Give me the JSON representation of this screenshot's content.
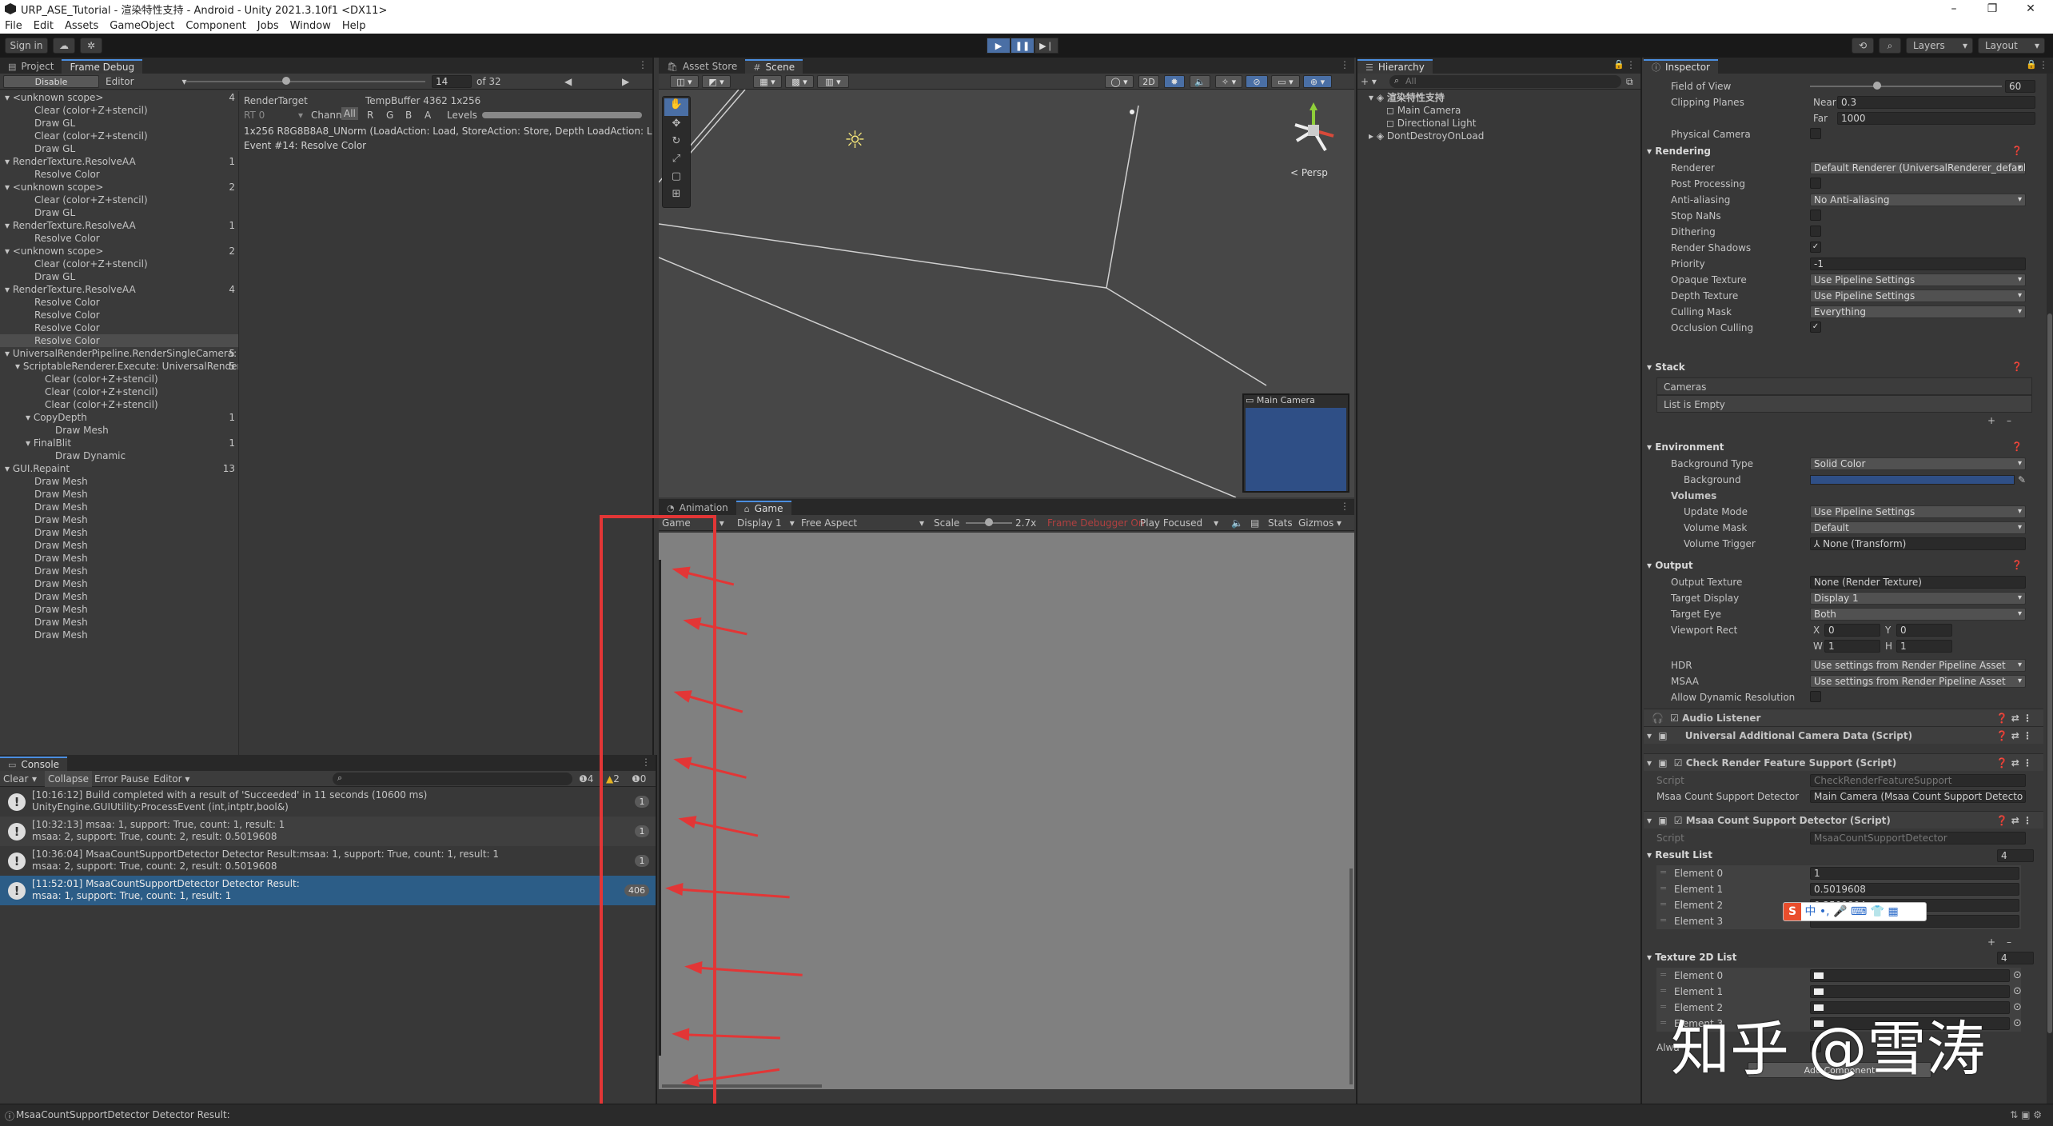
{
  "window": {
    "title": "URP_ASE_Tutorial - 渲染特性支持 - Android - Unity 2021.3.10f1 <DX11>",
    "controls": [
      "–",
      "❐",
      "✕"
    ]
  },
  "menu": [
    "File",
    "Edit",
    "Assets",
    "GameObject",
    "Component",
    "Jobs",
    "Window",
    "Help"
  ],
  "toolbar": {
    "sign_in": "Sign in",
    "layers": "Layers",
    "layout": "Layout"
  },
  "left_panel": {
    "tabs": [
      "Project",
      "Frame Debug"
    ],
    "disable_btn": "Disable",
    "editor_dd": "Editor",
    "frame_value": "14",
    "frame_total": "of 32",
    "frame_fraction": 0.42,
    "render_target_label": "RenderTarget",
    "render_target_value": "TempBuffer 4362 1x256",
    "rt_label": "RT 0",
    "channels_label": "Channels",
    "channels": [
      "All",
      "R",
      "G",
      "B",
      "A"
    ],
    "levels_label": "Levels",
    "format_line": "1x256 R8G8B8A8_UNorm (LoadAction: Load, StoreAction: Store, Depth LoadAction: Load, D",
    "event_line": "Event #14: Resolve Color",
    "events": [
      {
        "text": "▾ <unknown scope>",
        "count": "4",
        "indent": 0
      },
      {
        "text": "Clear (color+Z+stencil)",
        "count": "",
        "indent": 1
      },
      {
        "text": "Draw GL",
        "count": "",
        "indent": 1
      },
      {
        "text": "Clear (color+Z+stencil)",
        "count": "",
        "indent": 1
      },
      {
        "text": "Draw GL",
        "count": "",
        "indent": 1
      },
      {
        "text": "▾ RenderTexture.ResolveAA",
        "count": "1",
        "indent": 0
      },
      {
        "text": "Resolve Color",
        "count": "",
        "indent": 1
      },
      {
        "text": "▾ <unknown scope>",
        "count": "2",
        "indent": 0
      },
      {
        "text": "Clear (color+Z+stencil)",
        "count": "",
        "indent": 1
      },
      {
        "text": "Draw GL",
        "count": "",
        "indent": 1
      },
      {
        "text": "▾ RenderTexture.ResolveAA",
        "count": "1",
        "indent": 0
      },
      {
        "text": "Resolve Color",
        "count": "",
        "indent": 1
      },
      {
        "text": "▾ <unknown scope>",
        "count": "2",
        "indent": 0
      },
      {
        "text": "Clear (color+Z+stencil)",
        "count": "",
        "indent": 1
      },
      {
        "text": "Draw GL",
        "count": "",
        "indent": 1
      },
      {
        "text": "▾ RenderTexture.ResolveAA",
        "count": "4",
        "indent": 0
      },
      {
        "text": "Resolve Color",
        "count": "",
        "indent": 1
      },
      {
        "text": "Resolve Color",
        "count": "",
        "indent": 1
      },
      {
        "text": "Resolve Color",
        "count": "",
        "indent": 1
      },
      {
        "text": "Resolve Color",
        "count": "",
        "indent": 1,
        "selected": true
      },
      {
        "text": "▾ UniversalRenderPipeline.RenderSingleCamera: I",
        "count": "5",
        "indent": 0
      },
      {
        "text": "▾ ScriptableRenderer.Execute: UniversalRender",
        "count": "5",
        "indent": 1
      },
      {
        "text": "Clear (color+Z+stencil)",
        "count": "",
        "indent": 2
      },
      {
        "text": "Clear (color+Z+stencil)",
        "count": "",
        "indent": 2
      },
      {
        "text": "Clear (color+Z+stencil)",
        "count": "",
        "indent": 2
      },
      {
        "text": "▾ CopyDepth",
        "count": "1",
        "indent": 2
      },
      {
        "text": "Draw Mesh",
        "count": "",
        "indent": 3
      },
      {
        "text": "▾ FinalBlit",
        "count": "1",
        "indent": 2
      },
      {
        "text": "Draw Dynamic",
        "count": "",
        "indent": 3
      },
      {
        "text": "▾ GUI.Repaint",
        "count": "13",
        "indent": 0
      },
      {
        "text": "Draw Mesh",
        "count": "",
        "indent": 1
      },
      {
        "text": "Draw Mesh",
        "count": "",
        "indent": 1
      },
      {
        "text": "Draw Mesh",
        "count": "",
        "indent": 1
      },
      {
        "text": "Draw Mesh",
        "count": "",
        "indent": 1
      },
      {
        "text": "Draw Mesh",
        "count": "",
        "indent": 1
      },
      {
        "text": "Draw Mesh",
        "count": "",
        "indent": 1
      },
      {
        "text": "Draw Mesh",
        "count": "",
        "indent": 1
      },
      {
        "text": "Draw Mesh",
        "count": "",
        "indent": 1
      },
      {
        "text": "Draw Mesh",
        "count": "",
        "indent": 1
      },
      {
        "text": "Draw Mesh",
        "count": "",
        "indent": 1
      },
      {
        "text": "Draw Mesh",
        "count": "",
        "indent": 1
      },
      {
        "text": "Draw Mesh",
        "count": "",
        "indent": 1
      },
      {
        "text": "Draw Mesh",
        "count": "",
        "indent": 1
      }
    ]
  },
  "console": {
    "tab": "Console",
    "clear": "Clear",
    "collapse": "Collapse",
    "error_pause": "Error Pause",
    "editor": "Editor",
    "info_count": "4",
    "warn_count": "2",
    "error_count": "0",
    "logs": [
      {
        "l1": "[10:16:12] Build completed with a result of 'Succeeded' in 11 seconds (10600 ms)",
        "l2": "UnityEngine.GUIUtility:ProcessEvent (int,intptr,bool&)",
        "badge": "1"
      },
      {
        "l1": "[10:32:13] msaa:    1, support:  True, count:    1, result: 1",
        "l2": "msaa:    2, support:  True, count:    2, result: 0.5019608",
        "badge": "1"
      },
      {
        "l1": "[10:36:04] MsaaCountSupportDetector Detector Result:msaa:    1, support:  True, count:    1, result: 1",
        "l2": "msaa:    2, support:  True, count:    2, result: 0.5019608",
        "badge": "1"
      },
      {
        "l1": "[11:52:01] MsaaCountSupportDetector Detector Result:",
        "l2": "msaa:    1, support:  True, count:    1, result: 1",
        "badge": "406"
      }
    ]
  },
  "scene": {
    "tabs": [
      "Asset Store",
      "Scene"
    ],
    "persp": "< Persp",
    "btn_2d": "2D",
    "cam_preview_title": "Main Camera"
  },
  "game": {
    "tabs": [
      "Animation",
      "Game"
    ],
    "game_dd": "Game",
    "display_dd": "Display 1",
    "aspect_dd": "Free Aspect",
    "scale_label": "Scale",
    "scale_value": "2.7x",
    "frame_debugger": "Frame Debugger On",
    "play_focused": "Play Focused",
    "stats": "Stats",
    "gizmos": "Gizmos"
  },
  "hierarchy": {
    "tab": "Hierarchy",
    "search_placeholder": "All",
    "items": [
      {
        "text": "渲染特性支持",
        "indent": 0,
        "bold": true
      },
      {
        "text": "Main Camera",
        "indent": 1
      },
      {
        "text": "Directional Light",
        "indent": 1
      },
      {
        "text": "DontDestroyOnLoad",
        "indent": 0
      }
    ]
  },
  "inspector": {
    "tab": "Inspector",
    "fov_label": "Field of View",
    "fov_value": "60",
    "fov_fraction": 0.35,
    "clipping_label": "Clipping Planes",
    "near_label": "Near",
    "near_value": "0.3",
    "far_label": "Far",
    "far_value": "1000",
    "physical_label": "Physical Camera",
    "rendering_section": "Rendering",
    "rendering": [
      {
        "label": "Renderer",
        "value": "Default Renderer (UniversalRenderer_default)",
        "kind": "dd"
      },
      {
        "label": "Post Processing",
        "value": "",
        "kind": "check"
      },
      {
        "label": "Anti-aliasing",
        "value": "No Anti-aliasing",
        "kind": "dd"
      },
      {
        "label": "Stop NaNs",
        "value": "",
        "kind": "check"
      },
      {
        "label": "Dithering",
        "value": "",
        "kind": "check"
      },
      {
        "label": "Render Shadows",
        "value": "✓",
        "kind": "check"
      },
      {
        "label": "Priority",
        "value": "-1",
        "kind": "field"
      },
      {
        "label": "Opaque Texture",
        "value": "Use Pipeline Settings",
        "kind": "dd"
      },
      {
        "label": "Depth Texture",
        "value": "Use Pipeline Settings",
        "kind": "dd"
      },
      {
        "label": "Culling Mask",
        "value": "Everything",
        "kind": "dd"
      },
      {
        "label": "Occlusion Culling",
        "value": "✓",
        "kind": "check"
      }
    ],
    "stack_section": "Stack",
    "cameras_label": "Cameras",
    "list_empty": "List is Empty",
    "environment_section": "Environment",
    "bg_type_label": "Background Type",
    "bg_type_value": "Solid Color",
    "bg_label": "Background",
    "bg_color": "#2f4f86",
    "volumes_label": "Volumes",
    "update_mode_label": "Update Mode",
    "update_mode_value": "Use Pipeline Settings",
    "volume_mask_label": "Volume Mask",
    "volume_mask_value": "Default",
    "volume_trigger_label": "Volume Trigger",
    "volume_trigger_value": "⅄ None (Transform)",
    "output_section": "Output",
    "output_texture_label": "Output Texture",
    "output_texture_value": "None (Render Texture)",
    "target_display_label": "Target Display",
    "target_display_value": "Display 1",
    "target_eye_label": "Target Eye",
    "target_eye_value": "Both",
    "viewport_label": "Viewport Rect",
    "vp_x_label": "X",
    "vp_x": "0",
    "vp_y_label": "Y",
    "vp_y": "0",
    "vp_w_label": "W",
    "vp_w": "1",
    "vp_h_label": "H",
    "vp_h": "1",
    "hdr_label": "HDR",
    "hdr_value": "Use settings from Render Pipeline Asset",
    "msaa_label": "MSAA",
    "msaa_value": "Use settings from Render Pipeline Asset",
    "dyn_res_label": "Allow Dynamic Resolution",
    "audio_listener": "Audio Listener",
    "urp_data": "Universal Additional Camera Data (Script)",
    "check_rf": "Check Render Feature Support (Script)",
    "script_label": "Script",
    "check_rf_script": "CheckRenderFeatureSupport",
    "msaa_detector_label": "Msaa Count Support Detector",
    "msaa_detector_value": "Main Camera (Msaa Count Support Detecto",
    "msaa_comp": "Msaa Count Support Detector (Script)",
    "msaa_script": "MsaaCountSupportDetector",
    "result_list_label": "Result List",
    "result_list_count": "4",
    "results": [
      {
        "label": "Element 0",
        "value": "1"
      },
      {
        "label": "Element 1",
        "value": "0.5019608"
      },
      {
        "label": "Element 2",
        "value": "0.2509804"
      },
      {
        "label": "Element 3",
        "value": ""
      }
    ],
    "tex_list_label": "Texture 2D List",
    "tex_list_count": "4",
    "textures": [
      "Element 0",
      "Element 1",
      "Element 2",
      "Element 3"
    ],
    "always_label": "Alwa",
    "add_component": "Add Component"
  },
  "ime_bar": "中 •, 🎤 ⌨ 👕 ▦",
  "watermark": "知乎 @雪涛",
  "status_text": "MsaaCountSupportDetector Detector Result:"
}
